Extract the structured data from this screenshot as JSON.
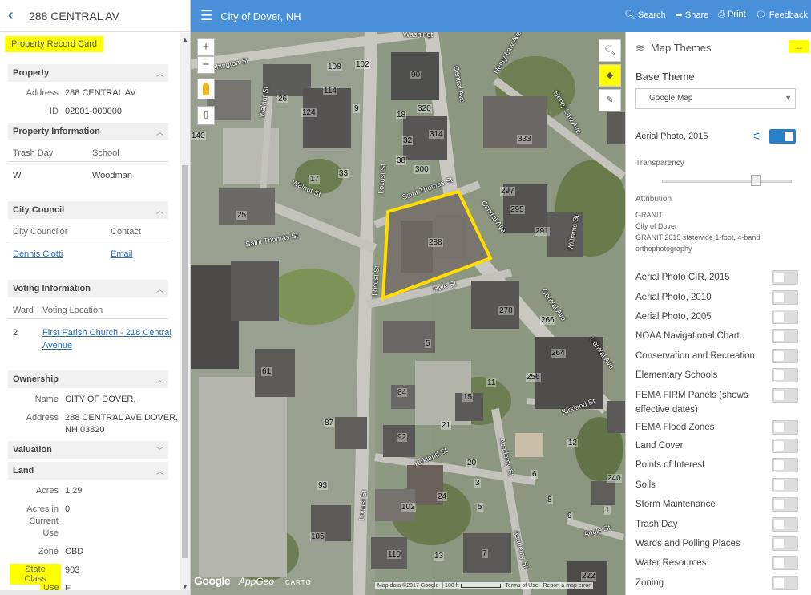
{
  "left_panel": {
    "back_icon": "chevron-left-icon",
    "title": "288 CENTRAL AV",
    "record_card_label": "Property Record Card",
    "sections": {
      "property": {
        "title": "Property",
        "address_label": "Address",
        "address_value": "288 CENTRAL AV",
        "id_label": "ID",
        "id_value": "02001-000000"
      },
      "property_information": {
        "title": "Property Information",
        "col1": "Trash Day",
        "col2": "School",
        "row_val1": "W",
        "row_val2": "Woodman"
      },
      "city_council": {
        "title": "City Council",
        "col1": "City Councilor",
        "col2": "Contact",
        "row_val1": "Dennis Ciotti",
        "row_val2": "Email"
      },
      "voting_information": {
        "title": "Voting Information",
        "col1": "Ward",
        "col2": "Voting Location",
        "row_val1": "2",
        "row_val2_line1": "First Parish Church - 218 Central",
        "row_val2_line2": "Avenue"
      },
      "ownership": {
        "title": "Ownership",
        "name_label": "Name",
        "name_value": "CITY OF DOVER,",
        "address_label": "Address",
        "address_line1": "288 CENTRAL AVE DOVER,",
        "address_line2": "NH 03820"
      },
      "valuation": {
        "title": "Valuation"
      },
      "land": {
        "title": "Land",
        "acres_label": "Acres",
        "acres_value": "1.29",
        "acres_cu_label_1": "Acres in",
        "acres_cu_label_2": "Current",
        "acres_cu_label_3": "Use",
        "acres_cu_value": "0",
        "zone_label": "Zone",
        "zone_value": "CBD",
        "state_class_label": "State Class",
        "state_class_value": "903",
        "use_label": "Use",
        "use_value": "E"
      }
    }
  },
  "topbar": {
    "menu_icon": "hamburger-icon",
    "city": "City of Dover, NH",
    "search": "Search",
    "share": "Share",
    "print": "Print",
    "feedback": "Feedback"
  },
  "map": {
    "zoom_in": "+",
    "zoom_out": "−",
    "street_labels": {
      "washington_top": "Washingt",
      "washington": "Washington St",
      "walnut": "Walnut St",
      "walnut2": "Walnut St",
      "locust": "Locust St",
      "locust2": "Locust St",
      "locust3": "Locust St",
      "saint_thomas": "Saint Thomas St",
      "saint_thomas2": "Saint Thomas St",
      "central": "Central Ave",
      "central2": "Central Ave",
      "central3": "Central Ave",
      "central4": "Central Ave",
      "henry_law": "Henry Law Ave",
      "henry_law2": "Henry Law Ave",
      "williams": "Williams St",
      "hale": "Hale St",
      "kirkland": "Kirkland St",
      "kirkland2": "Kirkland St",
      "academy": "Academy St",
      "academy2": "Academy St",
      "angle": "Angle St"
    },
    "parcel_numbers": [
      "108",
      "102",
      "90",
      "26",
      "124",
      "114",
      "9",
      "320",
      "18",
      "314",
      "32",
      "333",
      "33",
      "38",
      "300",
      "17",
      "25",
      "140",
      "297",
      "295",
      "291",
      "288",
      "278",
      "266",
      "5",
      "264",
      "61",
      "256",
      "84",
      "15",
      "11",
      "87",
      "21",
      "92",
      "12",
      "20",
      "6",
      "240",
      "93",
      "102",
      "24",
      "3",
      "5",
      "8",
      "9",
      "105",
      "110",
      "13",
      "7",
      "222",
      "1"
    ],
    "footer": {
      "google": "Google",
      "appgeo": "AppGeo",
      "carto": "CARTO",
      "data": "Map data ©2017 Google",
      "scale": "100 ft",
      "terms": "Terms of Use",
      "report": "Report a map error"
    },
    "tools": [
      "search-icon",
      "layers-icon",
      "brush-icon"
    ]
  },
  "themes_panel": {
    "title": "Map Themes",
    "base_theme_label": "Base Theme",
    "base_theme_value": "Google Map",
    "active_layer": "Aerial Photo, 2015",
    "transparency_label": "Transparency",
    "transparency": 0.72,
    "attribution_label": "Attribution",
    "attribution_lines": [
      "GRANIT",
      "City of Dover",
      "GRANIT 2015 statewide 1-foot, 4-band",
      "orthophotography"
    ],
    "themes": [
      "Aerial Photo CIR, 2015",
      "Aerial Photo, 2010",
      "Aerial Photo, 2005",
      "NOAA Navigational Chart",
      "Conservation and Recreation",
      "Elementary Schools",
      "FEMA FIRM Panels (shows effective dates)",
      "FEMA Flood Zones",
      "Land Cover",
      "Points of Interest",
      "Soils",
      "Storm Maintenance",
      "Trash Day",
      "Wards and Polling Places",
      "Water Resources",
      "Zoning"
    ]
  },
  "colors": {
    "accent": "#4a90d9",
    "highlight": "#ffff00",
    "parcel_outline": "#ffdd00",
    "toggle_on": "#2a7fc9"
  }
}
